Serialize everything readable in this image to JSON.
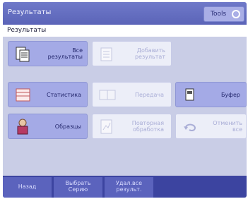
{
  "window": {
    "title": "Результаты",
    "tools_label": "Tools"
  },
  "subtitle": "Результаты",
  "tiles": {
    "all_results": {
      "line1": "Все",
      "line2": "результаты"
    },
    "add_result": {
      "line1": "Добавить",
      "line2": "результат"
    },
    "statistics": {
      "label": "Статистика"
    },
    "transfer": {
      "label": "Передача"
    },
    "buffer": {
      "label": "Буфер"
    },
    "samples": {
      "label": "Образцы"
    },
    "reprocess": {
      "line1": "Повторная",
      "line2": "обработка"
    },
    "undo_all": {
      "line1": "Отменить",
      "line2": "все"
    }
  },
  "softkeys": [
    {
      "line1": "Назад",
      "line2": ""
    },
    {
      "line1": "Выбрать",
      "line2": "Серию"
    },
    {
      "line1": "Удал.все",
      "line2": "результ."
    }
  ],
  "colors": {
    "titlebar": "#5b64b8",
    "tile_active": "#a4aae6",
    "tile_disabled": "#eceef8",
    "bottombar": "#3c44a0"
  }
}
